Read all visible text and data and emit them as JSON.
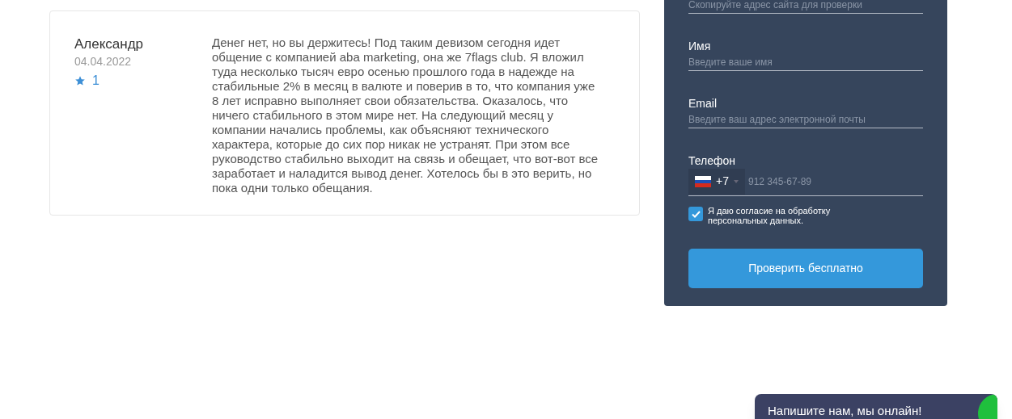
{
  "review": {
    "author": "Александр",
    "date": "04.04.2022",
    "rating": "1",
    "text": "Денег нет, но вы держитесь! Под таким девизом сегодня идет общение с компанией aba marketing, она же 7flags club. Я вложил туда несколько тысяч евро осенью прошлого года в надежде на стабильные 2% в месяц в валюте и поверив в то, что компания уже 8 лет исправно выполняет свои обязательства. Оказалось, что ничего стабильного в этом мире нет. На следующий месяц у компании начались проблемы, как объясняют технического характера, которые до сих пор никак не устранят. При этом все руководство стабильно выходит на связь и обещает, что вот-вот все заработает и наладится вывод денег. Хотелось бы в это верить, но пока одни только обещания."
  },
  "form": {
    "fields": [
      {
        "placeholder": "Скопируйте адрес сайта для проверки"
      },
      {
        "label": "Имя",
        "placeholder": "Введите ваше имя"
      },
      {
        "label": "Email",
        "placeholder": "Введите ваш адрес электронной почты"
      }
    ],
    "phone": {
      "label": "Телефон",
      "code": "+7",
      "placeholder": "912 345-67-89"
    },
    "consent": {
      "label": "Я даю согласие на обработку персональных данных.",
      "checked": true
    },
    "submit": "Проверить бесплатно"
  },
  "chat": {
    "label": "Напишите нам, мы онлайн!"
  }
}
